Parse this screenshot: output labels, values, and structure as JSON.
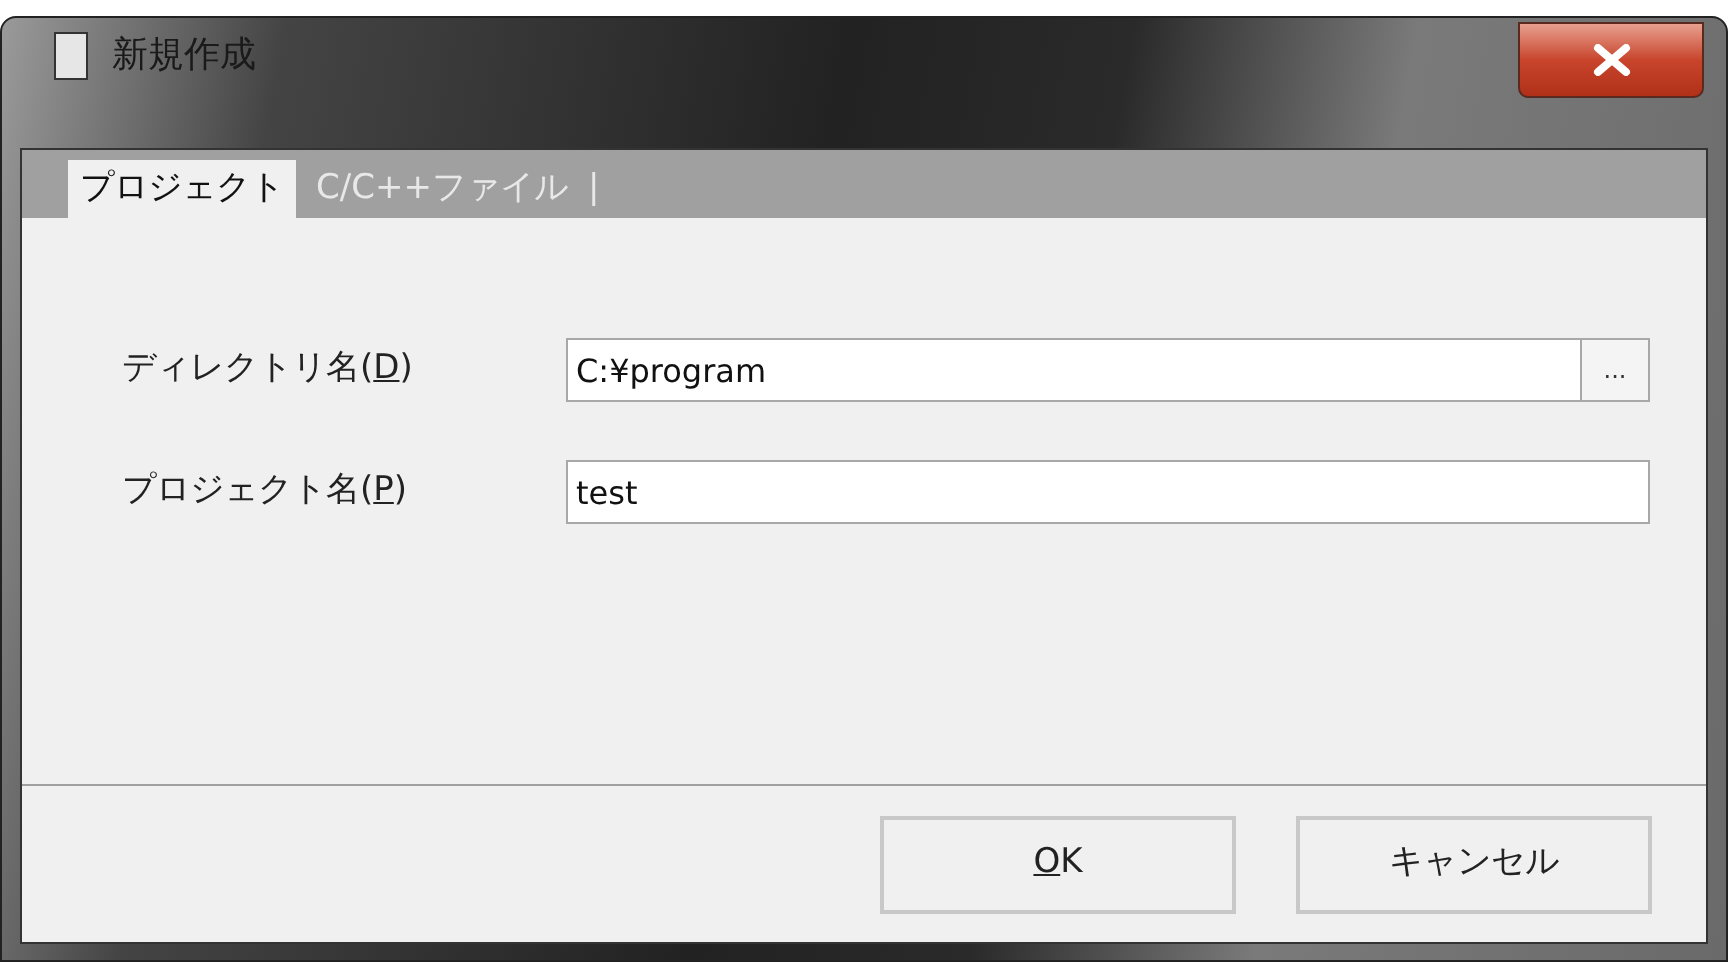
{
  "window": {
    "title": "新規作成"
  },
  "tabs": [
    {
      "label": "プロジェクト",
      "selected": true
    },
    {
      "label": "C/C++ファイル",
      "selected": false
    }
  ],
  "tab_separator": "|",
  "fields": [
    {
      "label_before": "ディレクトリ名(",
      "access_key": "D",
      "label_after": ")",
      "value": "C:¥program",
      "browse": "..."
    },
    {
      "label_before": "プロジェクト名(",
      "access_key": "P",
      "label_after": ")",
      "value": "test"
    }
  ],
  "buttons": [
    {
      "access_key": "O",
      "label_after": "K"
    },
    {
      "label_before": "キャンセル"
    }
  ]
}
